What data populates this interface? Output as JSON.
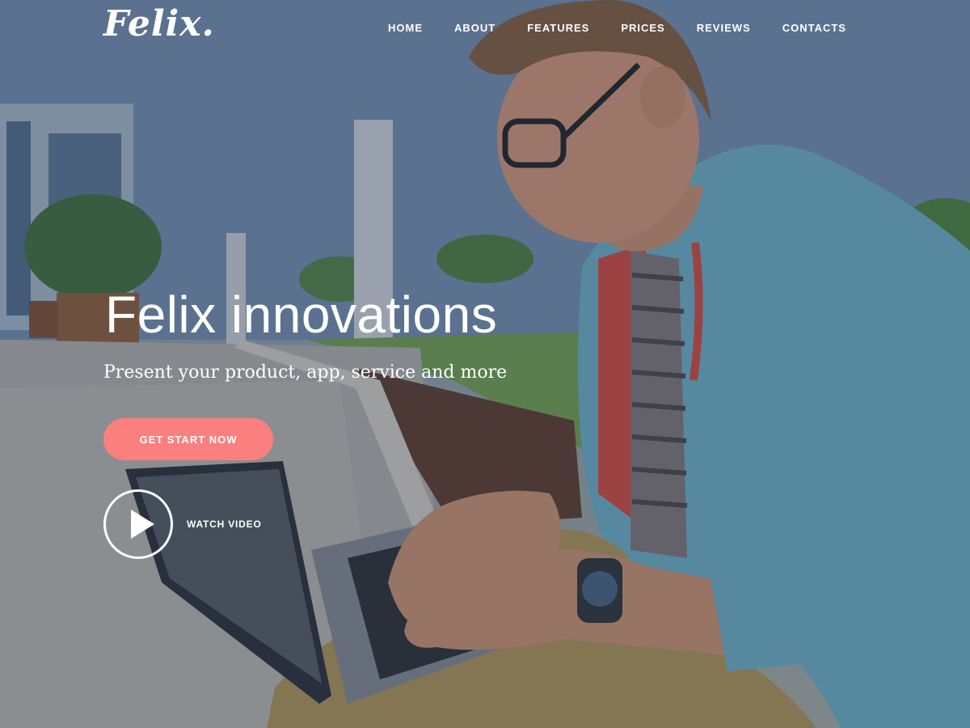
{
  "brand": {
    "logo_text": "Felix."
  },
  "nav": {
    "items": [
      {
        "label": "HOME"
      },
      {
        "label": "ABOUT"
      },
      {
        "label": "FEATURES"
      },
      {
        "label": "PRICES"
      },
      {
        "label": "REVIEWS"
      },
      {
        "label": "CONTACTS"
      }
    ]
  },
  "hero": {
    "title": "Felix innovations",
    "subtitle": "Present your product, app, service and more",
    "cta_label": "GET START NOW",
    "watch_label": "WATCH VIDEO"
  },
  "colors": {
    "accent": "#fb7f7f",
    "text": "#ffffff",
    "overlay": "#28374f"
  }
}
